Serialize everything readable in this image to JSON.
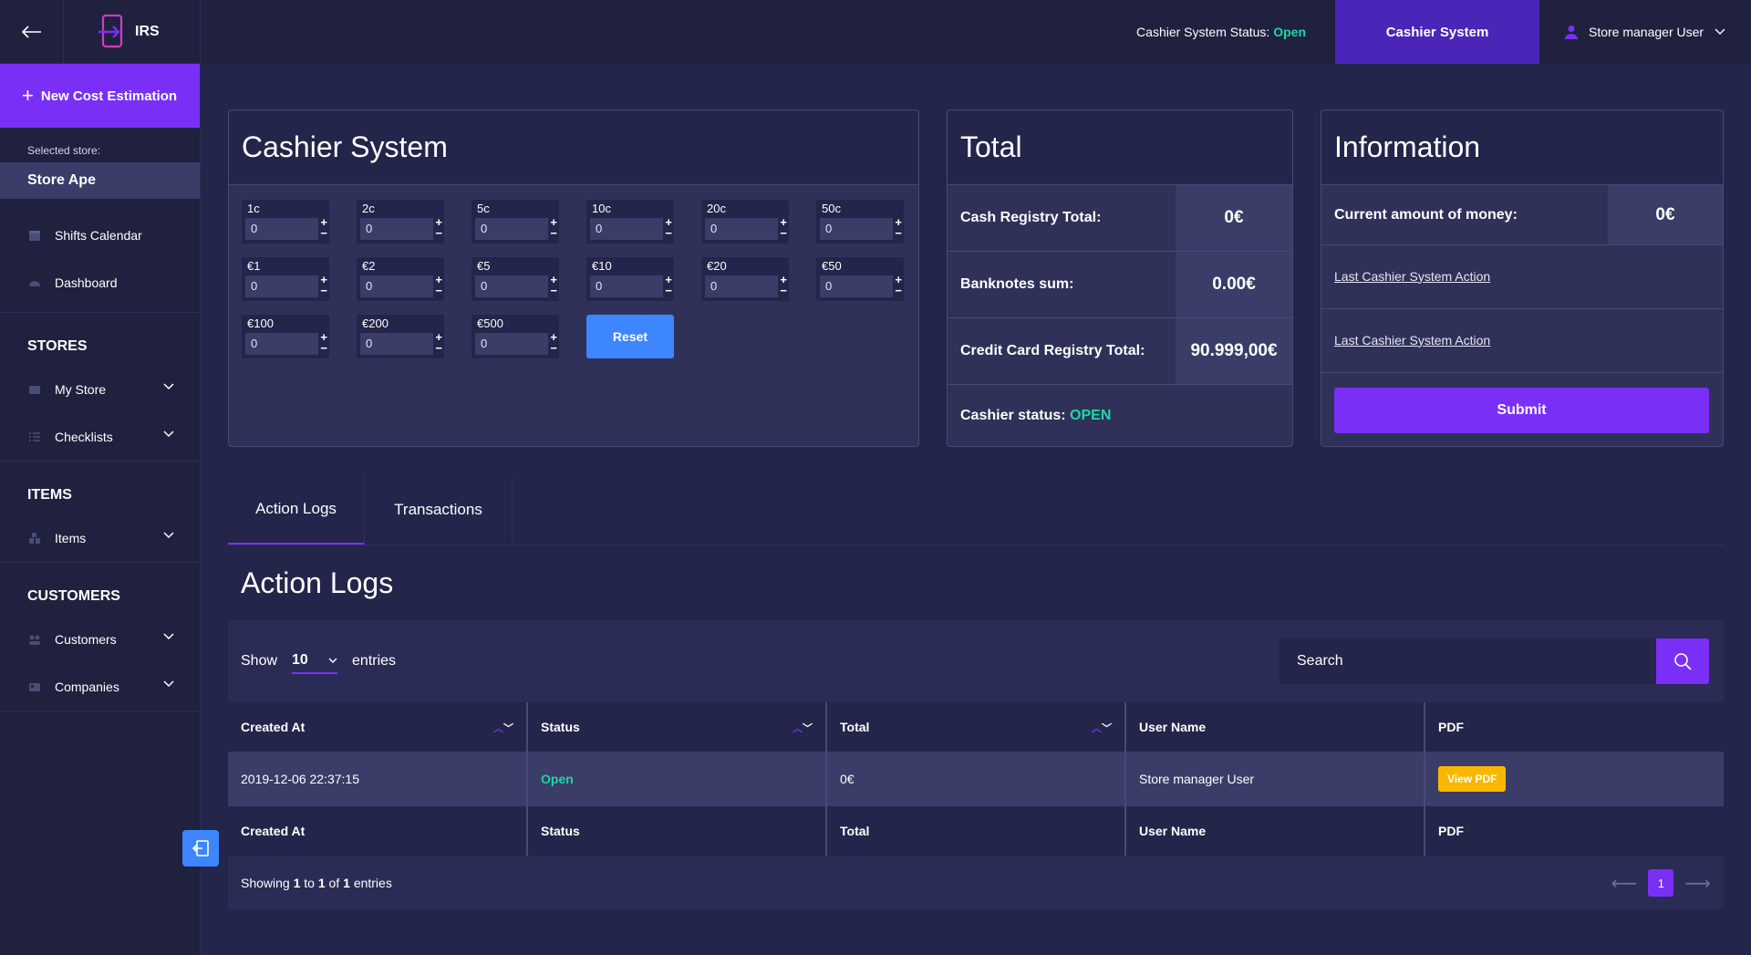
{
  "app": {
    "logo_text": "IRS"
  },
  "sidebar": {
    "new_cost_label": "New Cost Estimation",
    "selected_store_label": "Selected store:",
    "selected_store": "Store Ape",
    "top_items": [
      {
        "label": "Shifts Calendar",
        "icon": "calendar-icon"
      },
      {
        "label": "Dashboard",
        "icon": "dashboard-icon"
      }
    ],
    "sections": [
      {
        "title": "STORES",
        "items": [
          {
            "label": "My Store",
            "icon": "store-icon"
          },
          {
            "label": "Checklists",
            "icon": "list-icon"
          }
        ]
      },
      {
        "title": "ITEMS",
        "items": [
          {
            "label": "Items",
            "icon": "items-icon"
          }
        ]
      },
      {
        "title": "CUSTOMERS",
        "items": [
          {
            "label": "Customers",
            "icon": "users-icon"
          },
          {
            "label": "Companies",
            "icon": "card-icon"
          }
        ]
      }
    ]
  },
  "header": {
    "status_label": "Cashier System Status:",
    "status_value": "Open",
    "active_tab": "Cashier System",
    "user_name": "Store manager User"
  },
  "cashier": {
    "title": "Cashier System",
    "denominations": [
      {
        "label": "1c",
        "value": "0"
      },
      {
        "label": "2c",
        "value": "0"
      },
      {
        "label": "5c",
        "value": "0"
      },
      {
        "label": "10c",
        "value": "0"
      },
      {
        "label": "20c",
        "value": "0"
      },
      {
        "label": "50c",
        "value": "0"
      },
      {
        "label": "€1",
        "value": "0"
      },
      {
        "label": "€2",
        "value": "0"
      },
      {
        "label": "€5",
        "value": "0"
      },
      {
        "label": "€10",
        "value": "0"
      },
      {
        "label": "€20",
        "value": "0"
      },
      {
        "label": "€50",
        "value": "0"
      },
      {
        "label": "€100",
        "value": "0"
      },
      {
        "label": "€200",
        "value": "0"
      },
      {
        "label": "€500",
        "value": "0"
      }
    ],
    "reset_label": "Reset"
  },
  "total": {
    "title": "Total",
    "rows": [
      {
        "label": "Cash Registry Total:",
        "value": "0€"
      },
      {
        "label": "Banknotes sum:",
        "value": "0.00€"
      },
      {
        "label": "Credit Card Registry Total:",
        "value": "90.999,00€"
      }
    ],
    "cashier_status_label": "Cashier status:",
    "cashier_status_value": "OPEN"
  },
  "information": {
    "title": "Information",
    "current_label": "Current amount of money:",
    "current_value": "0€",
    "links": [
      "Last Cashier System Action",
      "Last Cashier System Action"
    ],
    "submit_label": "Submit"
  },
  "logs": {
    "tabs": [
      "Action Logs",
      "Transactions"
    ],
    "title": "Action Logs",
    "show_label": "Show",
    "show_value": "10",
    "entries_label": "entries",
    "search_placeholder": "Search",
    "columns": [
      "Created At",
      "Status",
      "Total",
      "User Name",
      "PDF"
    ],
    "rows": [
      {
        "created_at": "2019-12-06 22:37:15",
        "status": "Open",
        "total": "0€",
        "user": "Store manager User",
        "pdf": "View PDF"
      }
    ],
    "footer_prefix": "Showing",
    "footer_from": "1",
    "footer_to_word": "to",
    "footer_to": "1",
    "footer_of_word": "of",
    "footer_total": "1",
    "footer_suffix": "entries",
    "page": "1"
  },
  "colors": {
    "accent": "#7a2ff7",
    "blue": "#3d86ff",
    "status_green": "#1fd6a4",
    "pdf_yellow": "#f8b800"
  }
}
